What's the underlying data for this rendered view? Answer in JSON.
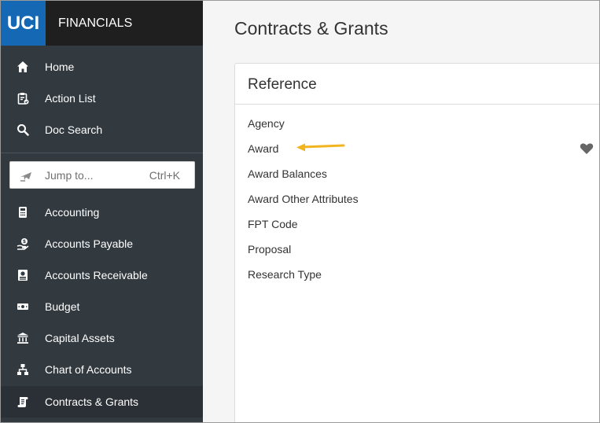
{
  "brand": {
    "logo_text": "UCI",
    "app_name": "FINANCIALS"
  },
  "sidebar": {
    "top_items": [
      {
        "label": "Home",
        "icon": "home-icon"
      },
      {
        "label": "Action List",
        "icon": "clipboard-icon"
      },
      {
        "label": "Doc Search",
        "icon": "search-icon"
      }
    ],
    "jump": {
      "placeholder": "Jump to...",
      "shortcut": "Ctrl+K",
      "icon": "plane-icon"
    },
    "modules": [
      {
        "label": "Accounting",
        "icon": "calculator-icon"
      },
      {
        "label": "Accounts Payable",
        "icon": "hand-coin-icon"
      },
      {
        "label": "Accounts Receivable",
        "icon": "invoice-icon"
      },
      {
        "label": "Budget",
        "icon": "money-icon"
      },
      {
        "label": "Capital Assets",
        "icon": "bank-icon"
      },
      {
        "label": "Chart of Accounts",
        "icon": "org-chart-icon"
      },
      {
        "label": "Contracts & Grants",
        "icon": "scroll-icon",
        "active": true
      }
    ]
  },
  "main": {
    "title": "Contracts & Grants",
    "reference": {
      "title": "Reference",
      "items": [
        "Agency",
        "Award",
        "Award Balances",
        "Award Other Attributes",
        "FPT Code",
        "Proposal",
        "Research Type"
      ],
      "favorite_item": "Award"
    }
  },
  "colors": {
    "accent": "#1468b4",
    "active_bar": "#3fb58b",
    "arrow": "#f2b51f",
    "sidebar": "#323a40"
  }
}
